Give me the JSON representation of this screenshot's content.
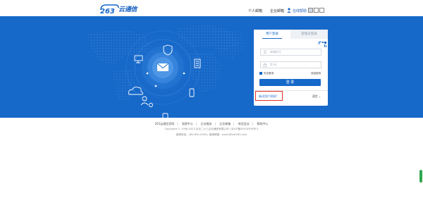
{
  "header": {
    "brand": "云通信",
    "nav_personal": "个人邮箱",
    "nav_enterprise": "企业邮箱",
    "nav_help": "在线帮助"
  },
  "login": {
    "tab_user": "用户登录",
    "tab_admin": "管理员登录",
    "username_placeholder": "邮箱帐号",
    "password_placeholder": "密 码",
    "secure_login": "安全登录",
    "forgot_password": "找回密码",
    "login_button": "登 录",
    "new_user": "新试用户须知?",
    "language": "语言"
  },
  "footer": {
    "links": [
      "263云通信官网",
      "党群中心",
      "企业服务",
      "企业邮箱",
      "电话会议",
      "帮助中心"
    ],
    "copyright": "Copyright © 1998-2023 北京二六三企业通信有限公司 | 京ICP备05010839号-3",
    "contact": "客服电话：400-650-0263 | 客服邮箱：smart@net263.com"
  },
  "colors": {
    "brand_blue": "#1668c9",
    "highlight_red": "#e0302a"
  }
}
